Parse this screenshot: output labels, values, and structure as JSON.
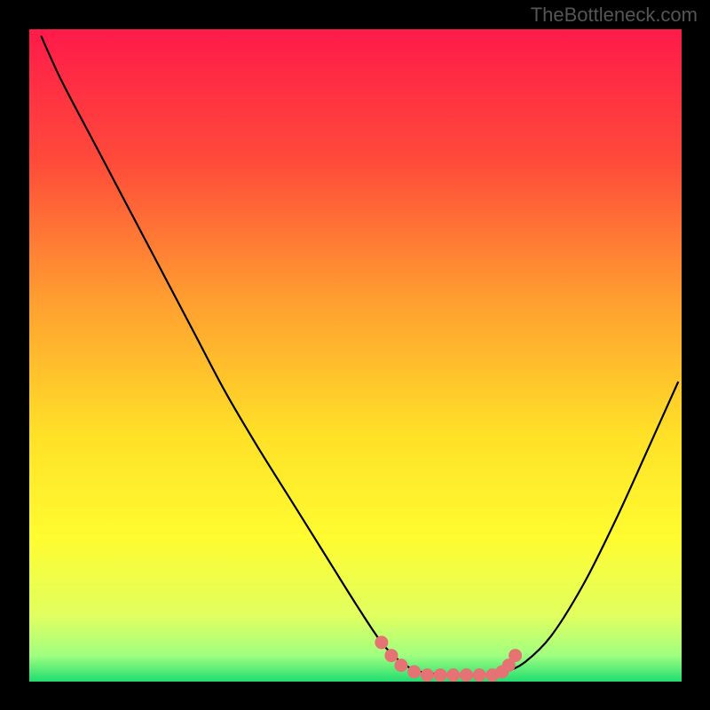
{
  "watermark": "TheBottleneck.com",
  "chart_data": {
    "type": "line",
    "title": "",
    "xlabel": "",
    "ylabel": "",
    "xlim": [
      0,
      100
    ],
    "ylim": [
      0,
      100
    ],
    "gradient_stops": [
      {
        "offset": 0.0,
        "color": "#ff1a4a"
      },
      {
        "offset": 0.2,
        "color": "#ff4a3a"
      },
      {
        "offset": 0.42,
        "color": "#ffa030"
      },
      {
        "offset": 0.62,
        "color": "#ffe028"
      },
      {
        "offset": 0.78,
        "color": "#fffc30"
      },
      {
        "offset": 0.9,
        "color": "#e0ff60"
      },
      {
        "offset": 0.96,
        "color": "#a0ff80"
      },
      {
        "offset": 1.0,
        "color": "#20dd70"
      }
    ],
    "series": [
      {
        "name": "curve",
        "type": "line",
        "color": "#000000",
        "points": [
          {
            "x": 1.8,
            "y": 99.0
          },
          {
            "x": 5.0,
            "y": 92.0
          },
          {
            "x": 10.0,
            "y": 82.5
          },
          {
            "x": 15.0,
            "y": 73.0
          },
          {
            "x": 20.0,
            "y": 63.5
          },
          {
            "x": 25.0,
            "y": 54.0
          },
          {
            "x": 30.0,
            "y": 44.5
          },
          {
            "x": 35.0,
            "y": 36.0
          },
          {
            "x": 40.0,
            "y": 28.0
          },
          {
            "x": 45.0,
            "y": 20.0
          },
          {
            "x": 50.0,
            "y": 12.0
          },
          {
            "x": 54.0,
            "y": 6.0
          },
          {
            "x": 57.0,
            "y": 3.0
          },
          {
            "x": 60.0,
            "y": 1.5
          },
          {
            "x": 65.0,
            "y": 1.0
          },
          {
            "x": 70.0,
            "y": 1.0
          },
          {
            "x": 73.0,
            "y": 1.5
          },
          {
            "x": 76.0,
            "y": 3.0
          },
          {
            "x": 80.0,
            "y": 7.0
          },
          {
            "x": 85.0,
            "y": 15.0
          },
          {
            "x": 90.0,
            "y": 25.0
          },
          {
            "x": 95.0,
            "y": 36.0
          },
          {
            "x": 99.5,
            "y": 46.0
          }
        ]
      },
      {
        "name": "markers",
        "type": "scatter",
        "color": "#e57373",
        "points": [
          {
            "x": 54.0,
            "y": 6.0
          },
          {
            "x": 55.5,
            "y": 4.0
          },
          {
            "x": 57.0,
            "y": 2.5
          },
          {
            "x": 59.0,
            "y": 1.5
          },
          {
            "x": 61.0,
            "y": 1.0
          },
          {
            "x": 63.0,
            "y": 1.0
          },
          {
            "x": 65.0,
            "y": 1.0
          },
          {
            "x": 67.0,
            "y": 1.0
          },
          {
            "x": 69.0,
            "y": 1.0
          },
          {
            "x": 71.0,
            "y": 1.0
          },
          {
            "x": 72.5,
            "y": 1.5
          },
          {
            "x": 73.5,
            "y": 2.5
          },
          {
            "x": 74.5,
            "y": 4.0
          }
        ]
      }
    ]
  }
}
